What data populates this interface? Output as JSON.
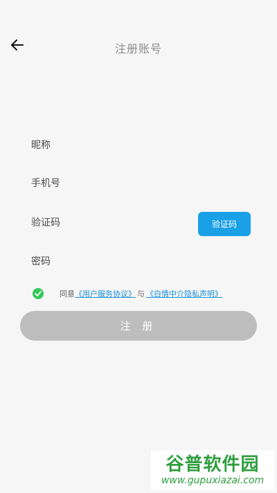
{
  "header": {
    "title": "注册账号",
    "back_icon": "arrow-left-icon"
  },
  "form": {
    "nickname_placeholder": "昵称",
    "phone_placeholder": "手机号",
    "code_placeholder": "验证码",
    "password_placeholder": "密码",
    "code_button_label": "验证码"
  },
  "agreement": {
    "checked": true,
    "prefix": "同意",
    "service_link": "《用户服务协议》",
    "connector": "与",
    "privacy_link": "《白情中介隐私声明》"
  },
  "register_button_label": "注 册",
  "watermark": {
    "top": "谷普软件园",
    "bottom": "www.gupuxiazai.com"
  },
  "colors": {
    "accent": "#1aa0e6",
    "check": "#34c759",
    "disabled_button": "#bdbdbd",
    "link": "#1a8fd8"
  }
}
